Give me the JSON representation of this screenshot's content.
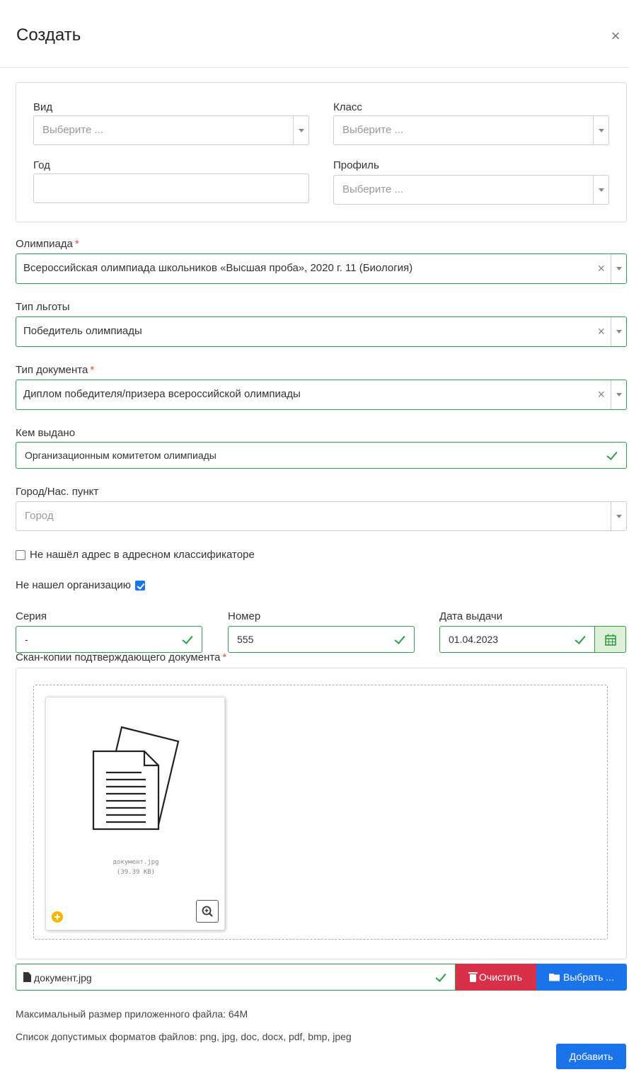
{
  "dialog": {
    "title": "Создать",
    "close": "×"
  },
  "filters": {
    "vid": {
      "label": "Вид",
      "placeholder": "Выберите ..."
    },
    "klass": {
      "label": "Класс",
      "placeholder": "Выберите ..."
    },
    "god": {
      "label": "Год",
      "value": ""
    },
    "profil": {
      "label": "Профиль",
      "placeholder": "Выберите ..."
    }
  },
  "olympiad": {
    "label": "Олимпиада",
    "required": "*",
    "value": "Всероссийская олимпиада школьников «Высшая проба», 2020 г. 11 (Биология)",
    "clear": "×"
  },
  "benefit_type": {
    "label": "Тип льготы",
    "value": "Победитель олимпиады",
    "clear": "×"
  },
  "doc_type": {
    "label": "Тип документа",
    "required": "*",
    "value": "Диплом победителя/призера всероссийской олимпиады",
    "clear": "×"
  },
  "issued_by": {
    "label": "Кем выдано",
    "value": "Организационным комитетом олимпиады"
  },
  "city": {
    "label": "Город/Нас. пункт",
    "placeholder": "Город"
  },
  "no_address": {
    "label": "Не нашёл адрес в адресном классификаторе",
    "checked": false
  },
  "no_org": {
    "label": "Не нашел организацию",
    "checked": true
  },
  "series": {
    "label": "Серия",
    "value": "-"
  },
  "number": {
    "label": "Номер",
    "value": "555"
  },
  "issue_date": {
    "label": "Дата выдачи",
    "value": "01.04.2023"
  },
  "scans": {
    "label": "Скан-копии подтверждающего документа",
    "required": "*",
    "file": {
      "name": "документ.jpg",
      "size": "(39.39 KB)"
    }
  },
  "file_input": {
    "filename": "документ.jpg",
    "clear_label": "Очистить",
    "choose_label": "Выбрать ..."
  },
  "info": {
    "max_size": "Максимальный размер приложенного файла: 64M",
    "formats": "Список допустимых форматов файлов: png, jpg, doc, docx, pdf, bmp, jpeg"
  },
  "submit_label": "Добавить",
  "colors": {
    "success": "#2e9e45",
    "primary": "#1a73e8",
    "danger": "#d9304a",
    "required": "#e74c3c"
  }
}
